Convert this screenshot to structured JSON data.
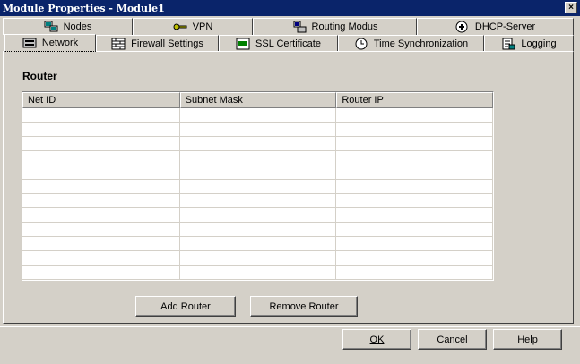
{
  "window": {
    "title": "Module Properties - Module1",
    "close_label": "×"
  },
  "tabs_row1": [
    {
      "label": "Nodes",
      "icon": "network-nodes-icon"
    },
    {
      "label": "VPN",
      "icon": "vpn-key-icon"
    },
    {
      "label": "Routing Modus",
      "icon": "routing-icon"
    },
    {
      "label": "DHCP-Server",
      "icon": "dhcp-server-icon"
    }
  ],
  "tabs_row2": [
    {
      "label": "Network",
      "icon": "network-card-icon",
      "selected": true
    },
    {
      "label": "Firewall Settings",
      "icon": "firewall-icon"
    },
    {
      "label": "SSL Certificate",
      "icon": "certificate-icon"
    },
    {
      "label": "Time Synchronization",
      "icon": "clock-icon"
    },
    {
      "label": "Logging",
      "icon": "logging-icon"
    }
  ],
  "router": {
    "section_title": "Router",
    "columns": [
      "Net ID",
      "Subnet Mask",
      "Router IP"
    ],
    "add_label": "Add Router",
    "remove_label": "Remove Router"
  },
  "footer": {
    "ok_label": "OK",
    "cancel_label": "Cancel",
    "help_label": "Help"
  }
}
